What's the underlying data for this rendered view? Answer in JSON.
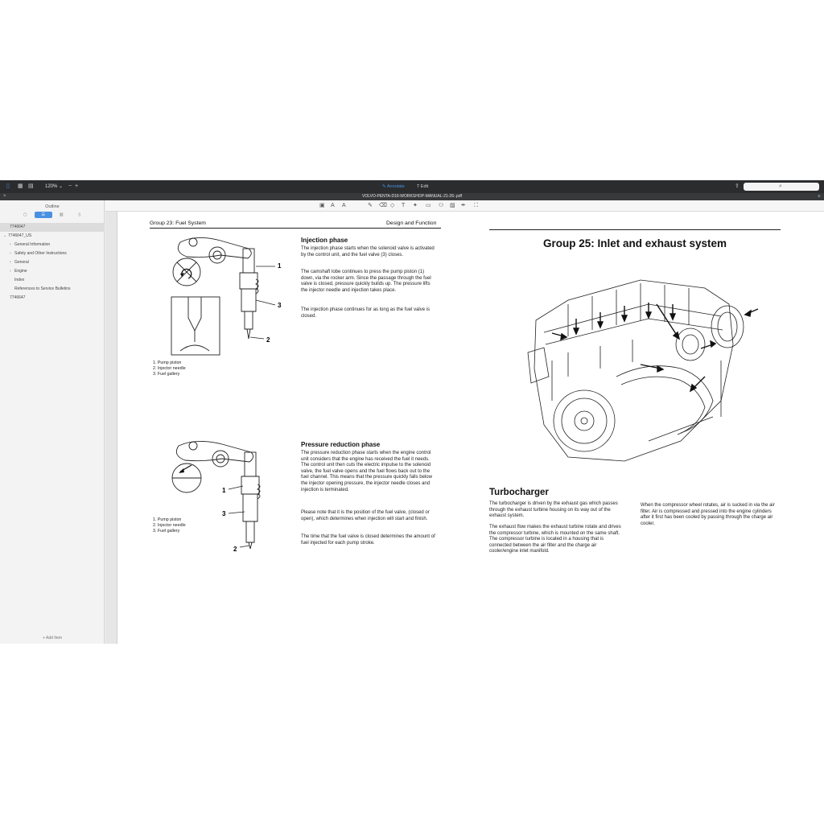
{
  "toolbar": {
    "zoom": "120%",
    "annotate_label": "Annotate",
    "edit_label": "Edit"
  },
  "tab": {
    "title": "VOLVO-PENTA-D16-WORKSHOP-MANUAL-21-26-.pdf"
  },
  "sidebar": {
    "title": "Outline",
    "items": [
      {
        "label": "7746647",
        "indent": 0
      },
      {
        "label": "7746647_US",
        "indent": 0
      },
      {
        "label": "General Information",
        "indent": 1
      },
      {
        "label": "Safety and Other Instructions",
        "indent": 1
      },
      {
        "label": "General",
        "indent": 1
      },
      {
        "label": "Engine",
        "indent": 1
      },
      {
        "label": "Index",
        "indent": 1
      },
      {
        "label": "References to Service Bulletins",
        "indent": 1
      },
      {
        "label": "7746647",
        "indent": 0
      }
    ],
    "add_item": "Add Item"
  },
  "left_page": {
    "header_left": "Group 23: Fuel System",
    "header_right": "Design and Function",
    "section1": {
      "title": "Injection phase",
      "paragraphs": [
        "The injection phase starts when the solenoid valve is activated by the control unit, and the fuel valve (3) closes.",
        "The camshaft lobe continues to press the pump piston (1) down, via the rocker arm. Since the passage through the fuel valve is closed, pressure quickly builds up. The pressure lifts the injector needle and injection takes place.",
        "The injection phase continues for as long as the fuel valve is closed."
      ],
      "legend": [
        "1.  Pump piston",
        "2.  Injector needle",
        "3.  Fuel gallery"
      ],
      "callouts": [
        "1",
        "3",
        "2"
      ]
    },
    "section2": {
      "title": "Pressure reduction phase",
      "paragraphs": [
        "The pressure reduction phase starts when the engine control unit considers that the engine has received the fuel it needs. The control unit then cuts the electric impulse to the solenoid valve, the fuel valve opens and the fuel flows back out to the fuel channel. This means that the pressure quickly falls below the injector opening pressure, the injector needle closes and injection is terminated.",
        "Please note that it is the position of the fuel valve, (closed or open), which determines when injection will start and finish.",
        "The time that the fuel valve is closed determines the amount of fuel injected for each pump stroke."
      ],
      "legend": [
        "1.  Pump piston",
        "2.  Injector needle",
        "3.  Fuel gallery"
      ],
      "callouts": [
        "1",
        "3",
        "2"
      ]
    }
  },
  "right_page": {
    "group_title": "Group 25: Inlet and exhaust system",
    "turbo_title": "Turbocharger",
    "col1": [
      "The turbocharger is driven by the exhaust gas which passes through the exhaust turbine housing on its way out of the exhaust system.",
      "The exhaust flow makes the exhaust turbine rotate and drives the compressor turbine, which is mounted on the same shaft. The compressor turbine is located in a housing that is connected between the air filter and the charge air cooler/engine inlet manifold."
    ],
    "col2": [
      "When the compressor wheel rotates, air is sucked in via the air filter. Air is compressed and pressed into the engine cylinders after it first has been cooled by passing through the charge air cooler."
    ]
  }
}
